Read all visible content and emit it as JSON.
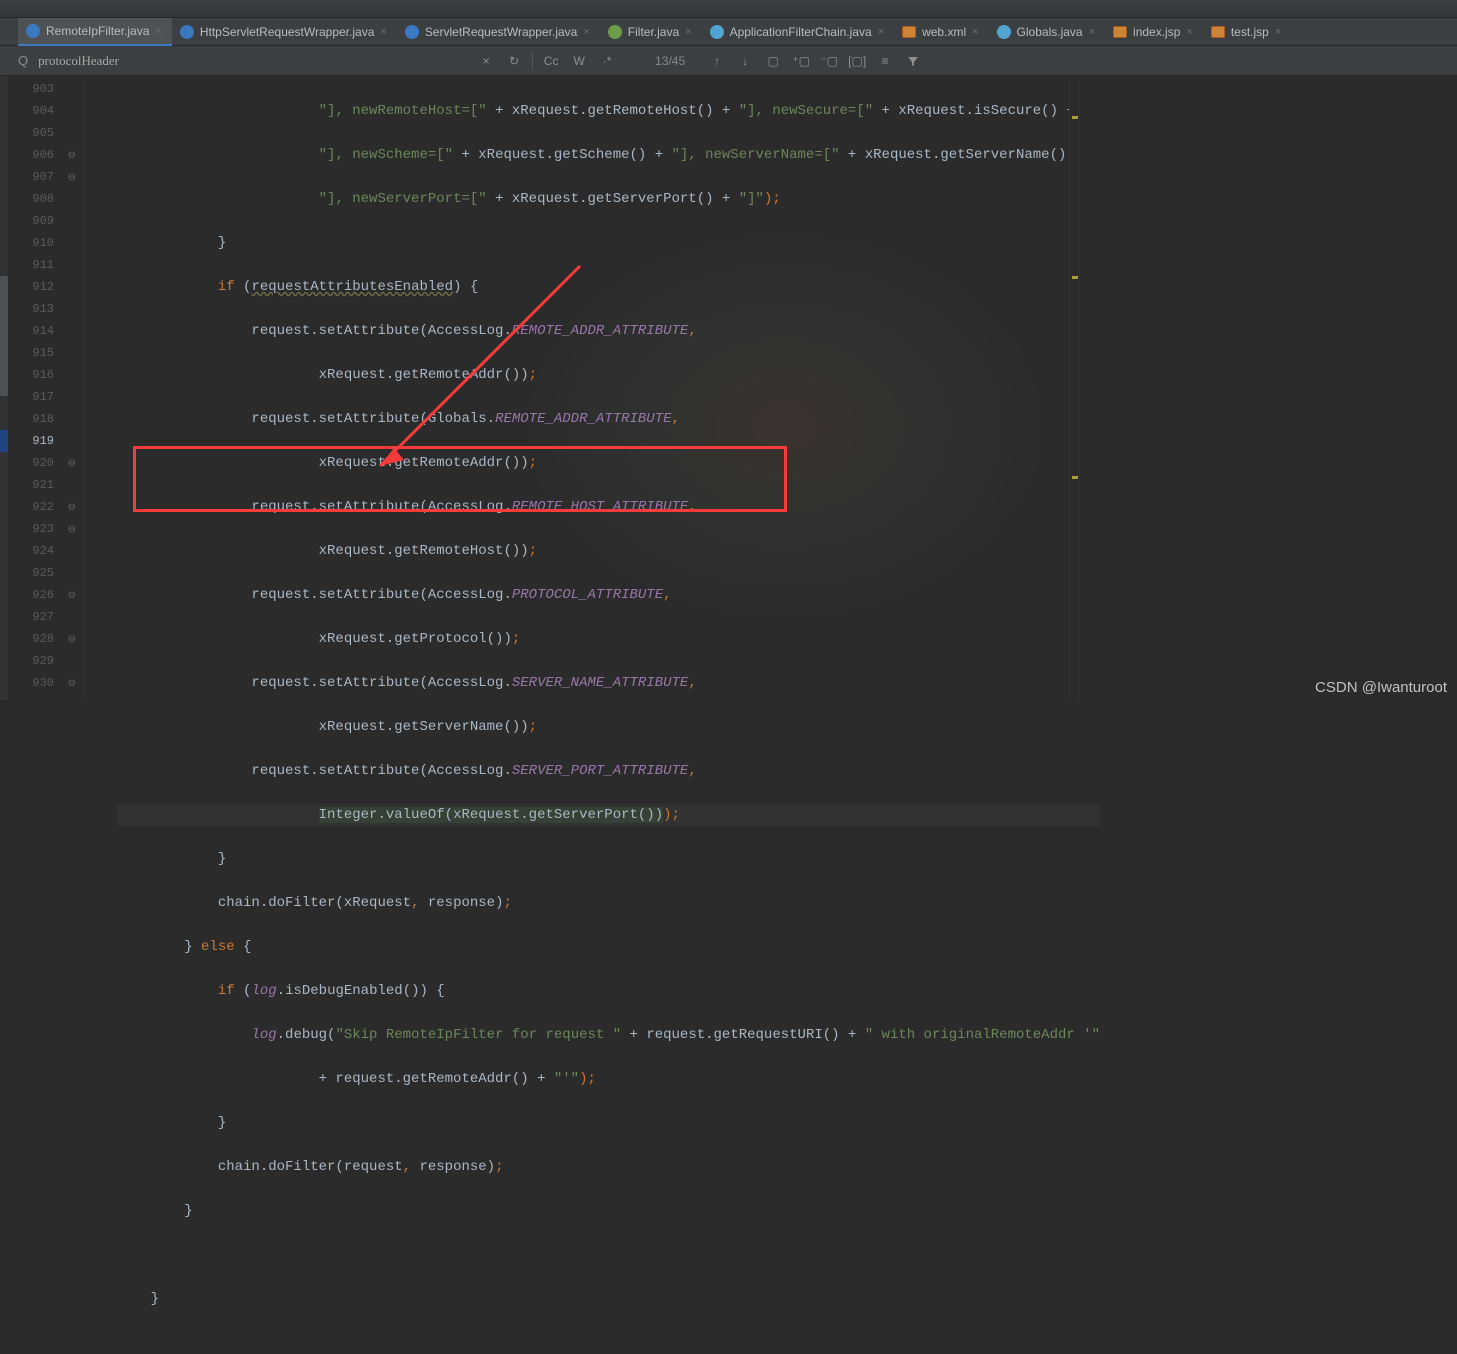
{
  "tabs": [
    {
      "label": "RemoteIpFilter.java",
      "icon": "ic-blue",
      "active": true
    },
    {
      "label": "HttpServletRequestWrapper.java",
      "icon": "ic-blue",
      "active": false
    },
    {
      "label": "ServletRequestWrapper.java",
      "icon": "ic-blue",
      "active": false
    },
    {
      "label": "Filter.java",
      "icon": "ic-green",
      "active": false
    },
    {
      "label": "ApplicationFilterChain.java",
      "icon": "ic-ltblue",
      "active": false
    },
    {
      "label": "web.xml",
      "icon": "ic-orange",
      "active": false
    },
    {
      "label": "Globals.java",
      "icon": "ic-ltblue",
      "active": false
    },
    {
      "label": "index.jsp",
      "icon": "ic-orange",
      "active": false
    },
    {
      "label": "test.jsp",
      "icon": "ic-orange",
      "active": false
    }
  ],
  "search": {
    "value": "protocolHeader",
    "count": "13/45"
  },
  "toolbar": {
    "close": "×",
    "prev": "↑",
    "next": "↓",
    "select": "⛶",
    "add": "+▢",
    "remove": "−▢",
    "toggle": "[]",
    "cc": "Cc",
    "w": "W",
    "star": "·*",
    "indent": "≡",
    "filter": "▼"
  },
  "gutter": {
    "start": 903,
    "end": 930,
    "highlight": 919
  },
  "code": {
    "l903": {
      "pre": "                        ",
      "s1": "\"], newRemoteHost=[\"",
      "m1": " + xRequest.getRemoteHost() + ",
      "s2": "\"], newSecure=[\"",
      "m2": " + xRequest.isSecure() +"
    },
    "l904": {
      "pre": "                        ",
      "s1": "\"], newScheme=[\"",
      "m1": " + xRequest.getScheme() + ",
      "s2": "\"], newServerName=[\"",
      "m2": " + xRequest.getServerName() +"
    },
    "l905": {
      "pre": "                        ",
      "s1": "\"], newServerPort=[\"",
      "m1": " + xRequest.getServerPort() + ",
      "s2": "\"]\"",
      "p": ");"
    },
    "l906": "            }",
    "l907": {
      "pre": "            ",
      "kw": "if",
      "paren": " (",
      "param": "requestAttributesEnabled",
      "end": ") {"
    },
    "l908": {
      "pre": "                request.setAttribute(AccessLog.",
      "c": "REMOTE_ADDR_ATTRIBUTE",
      "p": ","
    },
    "l909": {
      "pre": "                        xRequest.getRemoteAddr())",
      "p": ";"
    },
    "l910": {
      "pre": "                request.setAttribute(Globals.",
      "c": "REMOTE_ADDR_ATTRIBUTE",
      "p": ","
    },
    "l911": {
      "pre": "                        xRequest.getRemoteAddr())",
      "p": ";"
    },
    "l912": {
      "pre": "                request.setAttribute(AccessLog.",
      "c": "REMOTE_HOST_ATTRIBUTE",
      "p": ","
    },
    "l913": {
      "pre": "                        xRequest.getRemoteHost())",
      "p": ";"
    },
    "l914": {
      "pre": "                request.setAttribute(AccessLog.",
      "c": "PROTOCOL_ATTRIBUTE",
      "p": ","
    },
    "l915": {
      "pre": "                        xRequest.getProtocol())",
      "p": ";"
    },
    "l916": {
      "pre": "                request.setAttribute(AccessLog.",
      "c": "SERVER_NAME_ATTRIBUTE",
      "p": ","
    },
    "l917": {
      "pre": "                        xRequest.getServerName())",
      "p": ";"
    },
    "l918": {
      "pre": "                request.setAttribute(AccessLog.",
      "c": "SERVER_PORT_ATTRIBUTE",
      "p": ","
    },
    "l919": {
      "pre": "                        ",
      "hl": "Integer.valueOf(xRequest.getServerPort())",
      "p": ");"
    },
    "l920": "            }",
    "l921": {
      "pre": "            chain.doFilter(xRequest",
      "c1": ",",
      "m": " response)",
      "p": ";"
    },
    "l922": {
      "pre": "        } ",
      "kw": "else",
      "end": " {"
    },
    "l923": {
      "pre": "            ",
      "kw": "if",
      "m": " (",
      "v": "log",
      "m2": ".isDebugEnabled()) {"
    },
    "l924": {
      "pre": "                ",
      "v": "log",
      "m1": ".debug(",
      "s1": "\"Skip RemoteIpFilter for request \"",
      "m2": " + request.getRequestURI() + ",
      "s2": "\" with originalRemoteAddr '\""
    },
    "l925": {
      "pre": "                        + request.getRemoteAddr() + ",
      "s": "\"'\"",
      "p": ");"
    },
    "l926": "            }",
    "l927": {
      "pre": "            chain.doFilter(request",
      "c1": ",",
      "m": " response)",
      "p": ";"
    },
    "l928": "        }",
    "l929": "",
    "l930": "    }"
  },
  "watermark": "CSDN @Iwanturoot"
}
